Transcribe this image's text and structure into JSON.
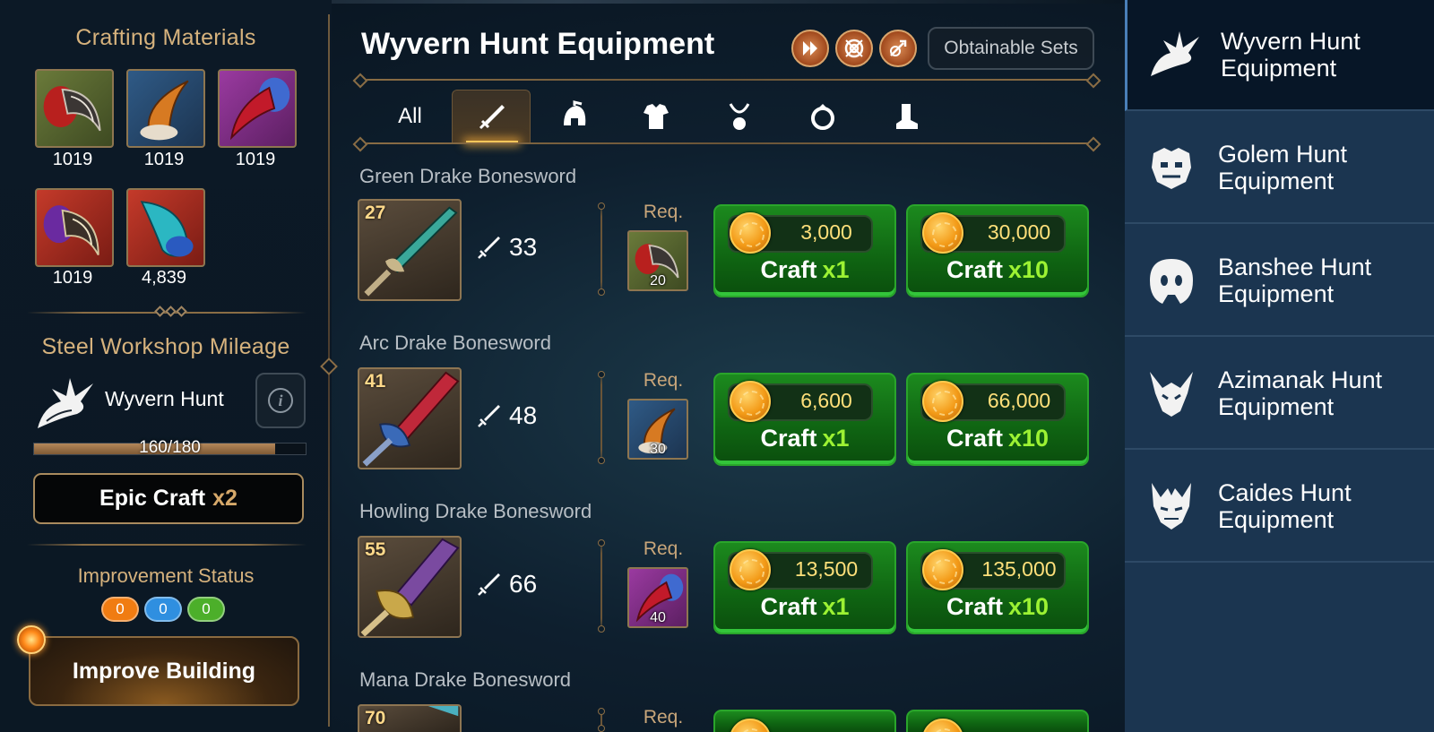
{
  "left": {
    "materials_title": "Crafting Materials",
    "materials": [
      {
        "icon": "red-claw-icon",
        "count": "1019"
      },
      {
        "icon": "amber-horn-icon",
        "count": "1019"
      },
      {
        "icon": "crimson-talon-icon",
        "count": "1019"
      },
      {
        "icon": "violet-claw-icon",
        "count": "1019"
      },
      {
        "icon": "cyan-fang-icon",
        "count": "4,839"
      }
    ],
    "mileage_title": "Steel Workshop Mileage",
    "mileage_name": "Wyvern Hunt",
    "mileage_progress": "160/180",
    "mileage_fraction": 0.889,
    "epic_craft_label": "Epic Craft",
    "epic_craft_mult": "x2",
    "improvement_title": "Improvement Status",
    "improvement_pills": [
      {
        "value": "0",
        "color": "#f07c12"
      },
      {
        "value": "0",
        "color": "#2f8fe0"
      },
      {
        "value": "0",
        "color": "#4caf2a"
      }
    ],
    "improve_button": "Improve Building"
  },
  "center": {
    "title": "Wyvern Hunt Equipment",
    "obtainable_sets": "Obtainable Sets",
    "tab_all": "All",
    "items": [
      {
        "name": "Green Drake Bonesword",
        "level": "27",
        "atk": "33",
        "req_label": "Req.",
        "req_count": "20",
        "req_mat": "red-claw-icon",
        "cost1": "3,000",
        "cost10": "30,000"
      },
      {
        "name": "Arc Drake Bonesword",
        "level": "41",
        "atk": "48",
        "req_label": "Req.",
        "req_count": "30",
        "req_mat": "amber-horn-icon",
        "cost1": "6,600",
        "cost10": "66,000"
      },
      {
        "name": "Howling Drake Bonesword",
        "level": "55",
        "atk": "66",
        "req_label": "Req.",
        "req_count": "40",
        "req_mat": "crimson-talon-icon",
        "cost1": "13,500",
        "cost10": "135,000"
      },
      {
        "name": "Mana Drake Bonesword",
        "level": "70",
        "req_label": "Req."
      }
    ],
    "craft_label": "Craft",
    "mult1": "x1",
    "mult10": "x10"
  },
  "sidebar": {
    "items": [
      {
        "label": "Wyvern Hunt Equipment",
        "icon": "wyvern-head-icon",
        "selected": true
      },
      {
        "label": "Golem Hunt Equipment",
        "icon": "golem-head-icon"
      },
      {
        "label": "Banshee Hunt Equipment",
        "icon": "banshee-head-icon"
      },
      {
        "label": "Azimanak Hunt Equipment",
        "icon": "azimanak-head-icon"
      },
      {
        "label": "Caides Hunt Equipment",
        "icon": "caides-head-icon"
      }
    ]
  },
  "colors": {
    "accent_gold": "#d6b27d",
    "craft_green": "#1c8a1e",
    "multiplier_green": "#9cf233",
    "coin_gold": "#ffe07a"
  }
}
